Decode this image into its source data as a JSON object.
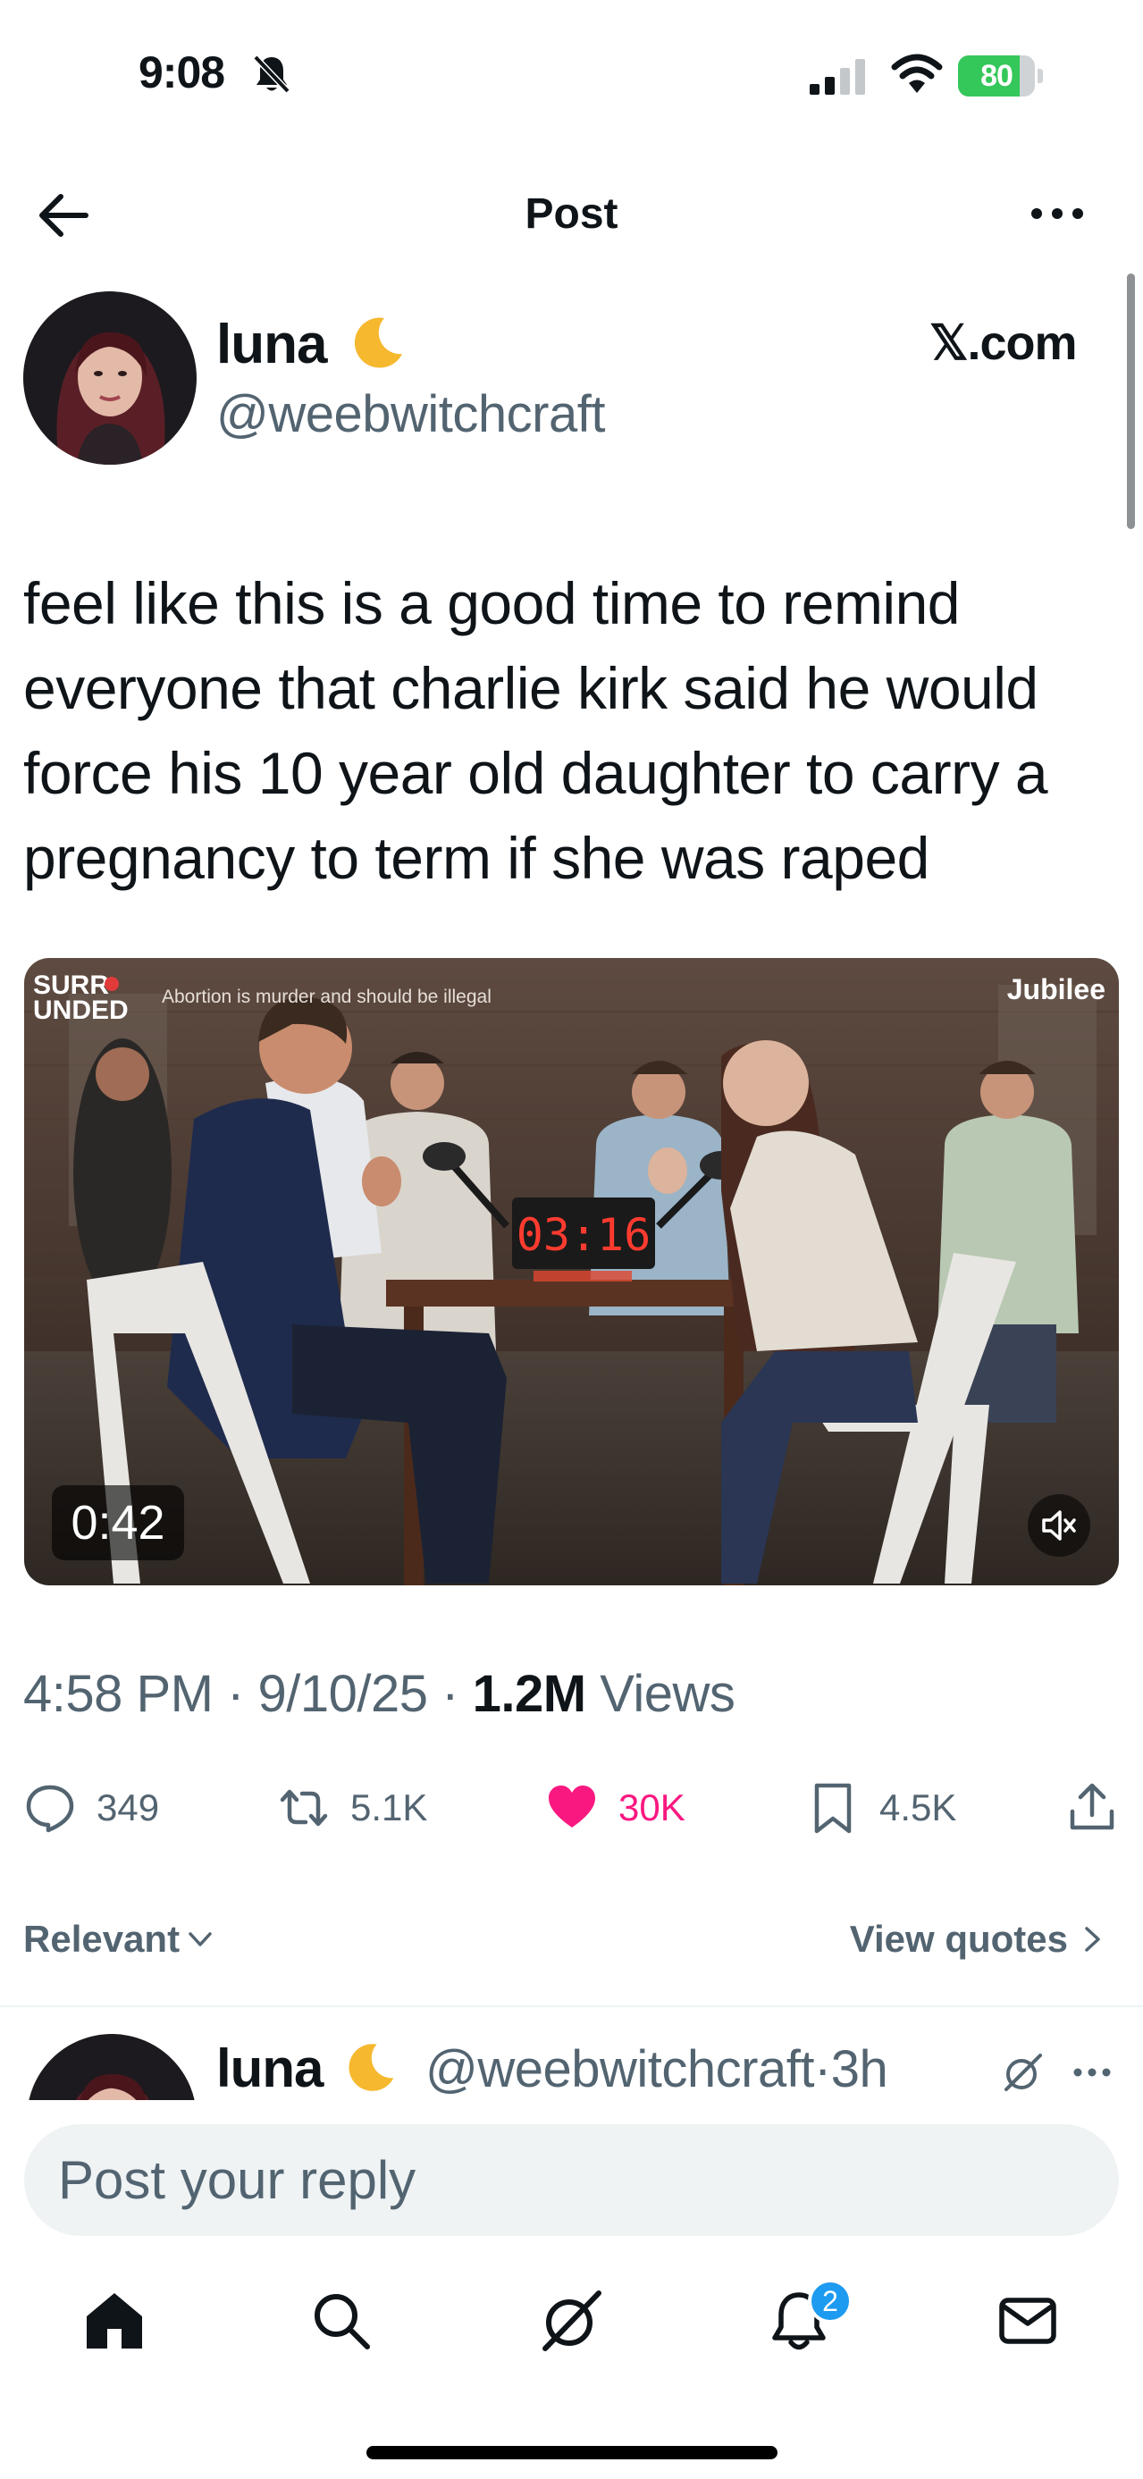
{
  "status_bar": {
    "time": "9:08",
    "battery": "80",
    "battery_level": 0.8
  },
  "header": {
    "title": "Post"
  },
  "post": {
    "author_name": "luna",
    "author_handle": "@weebwitchcraft",
    "source": "𝕏.com",
    "text": "feel like this is a good time to remind everyone that charlie kirk said he would force his 10 year old daughter to carry a pregnancy to term if she was raped",
    "media": {
      "show_logo_line1": "SURR",
      "show_logo_line2": "UNDED",
      "topic": "Abortion is murder and should be illegal",
      "brand": "Jubilee",
      "timer": "03:16",
      "duration": "0:42"
    },
    "time": "4:58 PM",
    "date": "9/10/25",
    "views_count": "1.2M",
    "views_label": "Views"
  },
  "actions": {
    "replies": "349",
    "reposts": "5.1K",
    "likes": "30K",
    "bookmarks": "4.5K"
  },
  "sort": {
    "label": "Relevant",
    "quotes_label": "View quotes"
  },
  "reply_preview": {
    "author_name": "luna",
    "handle_time": "@weebwitchcraft·3h"
  },
  "composer": {
    "placeholder": "Post your reply"
  },
  "nav": {
    "notifications_badge": "2"
  },
  "colors": {
    "like": "#f91880",
    "accent": "#1d9bf0",
    "secondary_text": "#536471",
    "battery_fill": "#34c759"
  }
}
